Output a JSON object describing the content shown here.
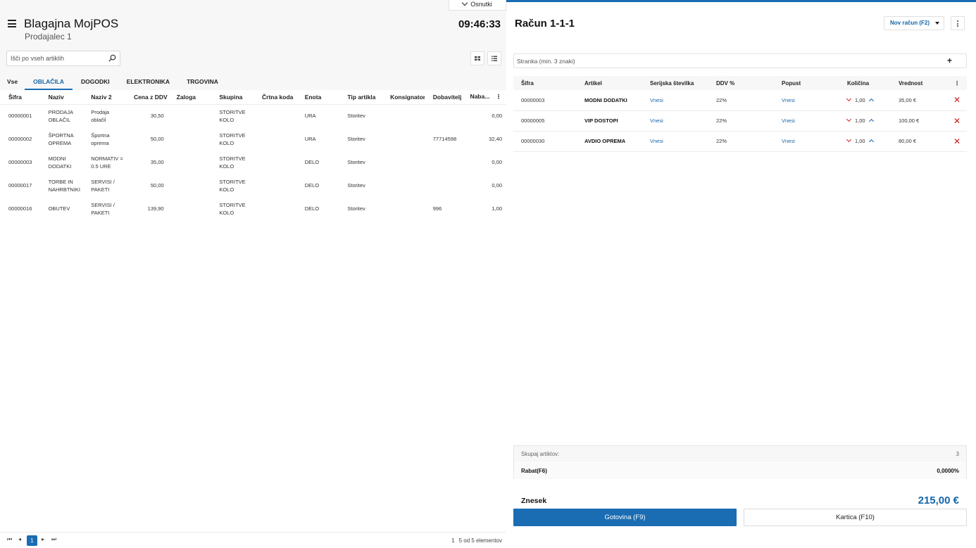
{
  "header": {
    "title": "Blagajna MojPOS",
    "subtitle": "Prodajalec 1",
    "clock": "09:46:33",
    "drafts_label": "Osnutki"
  },
  "search": {
    "placeholder": "Išči po vseh artiklih"
  },
  "tabs": [
    {
      "label": "Vse"
    },
    {
      "label": "OBLAČILA"
    },
    {
      "label": "DOGODKI"
    },
    {
      "label": "ELEKTRONIKA"
    },
    {
      "label": "TRGOVINA"
    }
  ],
  "grid": {
    "columns": [
      "Šifra",
      "Naziv",
      "Naziv 2",
      "Cena z DDV",
      "Zaloga",
      "Skupina",
      "Črtna koda",
      "Enota",
      "Tip artikla",
      "Konsignator",
      "Dobavitelj",
      "Naba..."
    ],
    "rows": [
      {
        "sifra": "00000001",
        "naziv": "PRODAJA OBLAČIL",
        "naziv2": "Prodaja oblačil",
        "cena": "30,50",
        "zaloga": "",
        "skupina": "STORITVE KOLO",
        "crtna": "",
        "enota": "URA",
        "tip": "Storitev",
        "konsignator": "",
        "dobavitelj": "",
        "nabava": "0,00"
      },
      {
        "sifra": "00000002",
        "naziv": "ŠPORTNA OPREMA",
        "naziv2": "Športna oprema",
        "cena": "50,00",
        "zaloga": "",
        "skupina": "STORITVE KOLO",
        "crtna": "",
        "enota": "URA",
        "tip": "Storitev",
        "konsignator": "",
        "dobavitelj": "77714598",
        "nabava": "32,40"
      },
      {
        "sifra": "00000003",
        "naziv": "MODNI DODATKI",
        "naziv2": "NORMATIV = 0.5 URE",
        "cena": "35,00",
        "zaloga": "",
        "skupina": "STORITVE KOLO",
        "crtna": "",
        "enota": "DELO",
        "tip": "Storitev",
        "konsignator": "",
        "dobavitelj": "",
        "nabava": "0,00"
      },
      {
        "sifra": "00000017",
        "naziv": "TORBE IN NAHRBTNIKI",
        "naziv2": "SERVISI / PAKETI",
        "cena": "50,00",
        "zaloga": "",
        "skupina": "STORITVE KOLO",
        "crtna": "",
        "enota": "DELO",
        "tip": "Storitev",
        "konsignator": "",
        "dobavitelj": "",
        "nabava": "0,00"
      },
      {
        "sifra": "00000016",
        "naziv": "OBUTEV",
        "naziv2": "SERVISI / PAKETI",
        "cena": "139,90",
        "zaloga": "",
        "skupina": "STORITVE KOLO",
        "crtna": "",
        "enota": "DELO",
        "tip": "Storitev",
        "konsignator": "",
        "dobavitelj": "996",
        "nabava": "1,00"
      }
    ]
  },
  "pager": {
    "first": "⏮",
    "prev": "◂",
    "current": "1",
    "next": "▸",
    "last": "⏭",
    "page_of": "1",
    "info": "5 od 5 elementov"
  },
  "receipt": {
    "title": "Račun 1-1-1",
    "new_receipt_label": "Nov račun (F2)",
    "customer_placeholder": "Stranka (min. 3 znaki)",
    "plus": "+",
    "columns": [
      "Šifra",
      "Artikel",
      "Serijska številka",
      "DDV %",
      "Popust",
      "Količina",
      "Vrednost"
    ],
    "lines": [
      {
        "sifra": "00000003",
        "artikel": "MODNI DODATKI",
        "serijska": "Vnesi",
        "ddv": "22%",
        "popust": "Vnesi",
        "kolicina": "1,00",
        "vrednost": "35,00 €"
      },
      {
        "sifra": "00000005",
        "artikel": "VIP DOSTOPI",
        "serijska": "Vnesi",
        "ddv": "22%",
        "popust": "Vnesi",
        "kolicina": "1,00",
        "vrednost": "100,00 €"
      },
      {
        "sifra": "00000030",
        "artikel": "AVDIO OPREMA",
        "serijska": "Vnesi",
        "ddv": "22%",
        "popust": "Vnesi",
        "kolicina": "1,00",
        "vrednost": "80,00 €"
      }
    ],
    "summary": {
      "items_label": "Skupaj artiklov:",
      "items_value": "3",
      "discount_label": "Rabat(F6)",
      "discount_value": "0,0000%"
    },
    "total_label": "Znesek",
    "total_value": "215,00 €",
    "cash_label": "Gotovina (F9)",
    "card_label": "Kartica (F10)"
  },
  "colors": {
    "accent": "#1a6db3",
    "danger": "#d01818"
  }
}
